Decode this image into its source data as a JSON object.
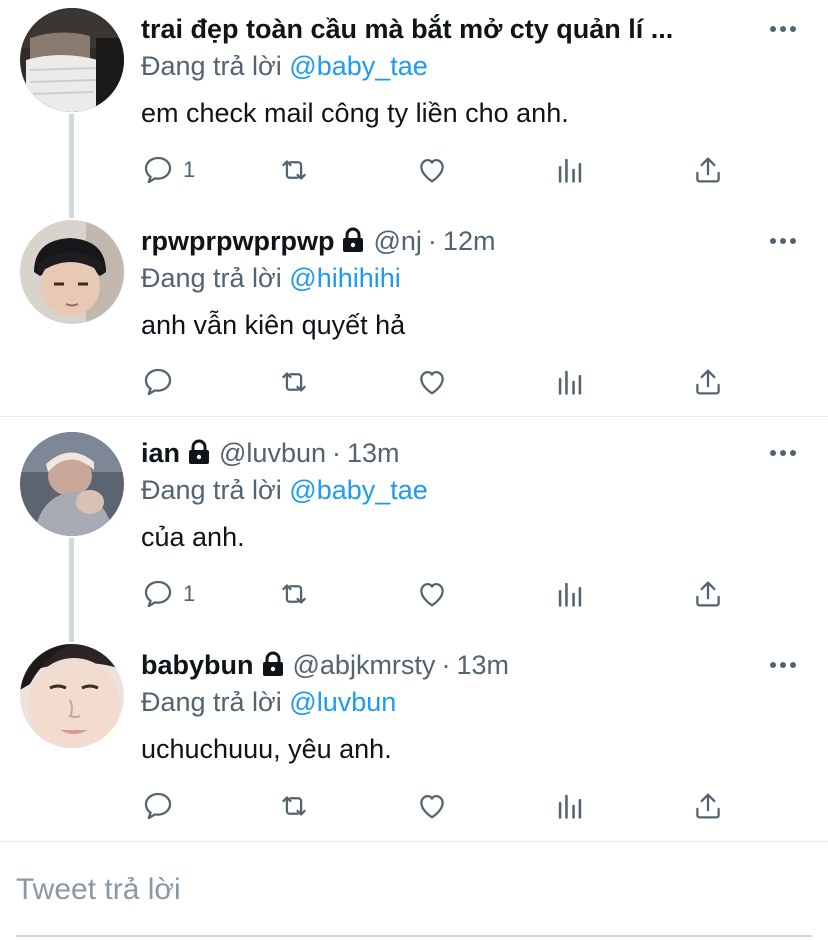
{
  "colors": {
    "link": "#1d9bf0",
    "muted": "#536471",
    "text": "#0f1419",
    "divider": "#e6ecf0"
  },
  "tweets": [
    {
      "name": "trai đẹp toàn cầu mà bắt mở cty quản lí ...",
      "handle": "",
      "time": "",
      "locked": false,
      "reply_prefix": "Đang trả lời",
      "reply_mention": "@baby_tae",
      "text": "em check mail công ty liền cho anh.",
      "reply_count": "1",
      "avatar": "avatar-masked-person"
    },
    {
      "name": "rpwprpwprpwp",
      "handle": "@nj",
      "time": "12m",
      "locked": true,
      "reply_prefix": "Đang trả lời",
      "reply_mention": "@hihihihi",
      "text": "anh vẫn kiên quyết hả",
      "reply_count": "",
      "avatar": "avatar-dark-hair-person"
    },
    {
      "name": "ian",
      "handle": "@luvbun",
      "time": "13m",
      "locked": true,
      "reply_prefix": "Đang trả lời",
      "reply_mention": "@baby_tae",
      "text": "của anh.",
      "reply_count": "1",
      "avatar": "avatar-blurry-person"
    },
    {
      "name": "babybun",
      "handle": "@abjkmrsty",
      "time": "13m",
      "locked": true,
      "reply_prefix": "Đang trả lời",
      "reply_mention": "@luvbun",
      "text": "uchuchuuu, yêu anh.",
      "reply_count": "",
      "avatar": "avatar-face-closeup"
    }
  ],
  "dot": "·",
  "icons": [
    "reply-icon",
    "retweet-icon",
    "like-icon",
    "analytics-icon",
    "share-icon",
    "more-icon",
    "lock-icon"
  ],
  "reply_box": {
    "placeholder": "Tweet trả lời"
  }
}
